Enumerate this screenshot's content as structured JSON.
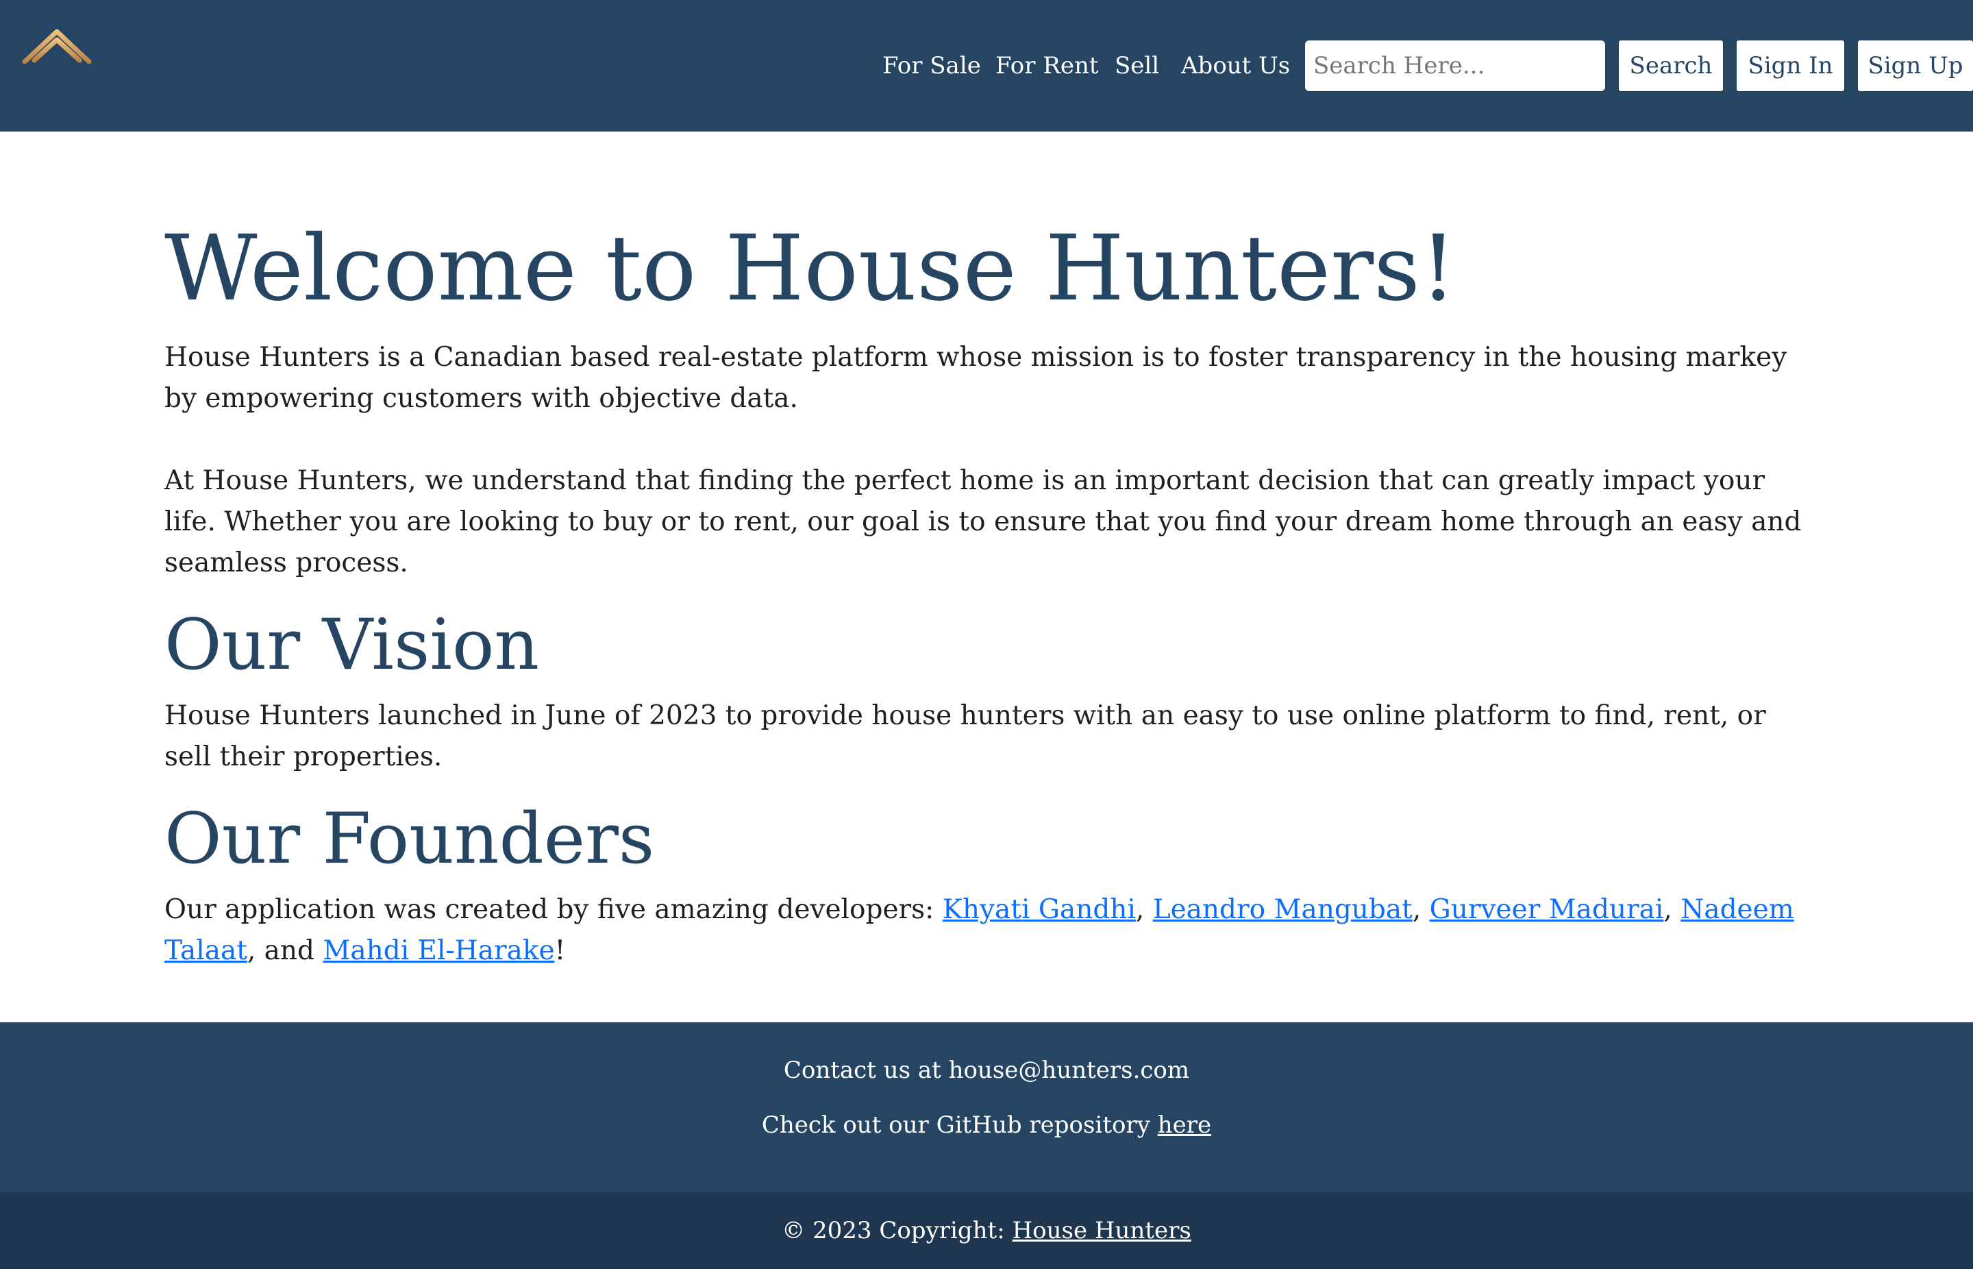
{
  "header": {
    "logo_icon": "house-hunters-logo-icon",
    "nav": {
      "for_sale": "For Sale",
      "for_rent": "For Rent",
      "sell": "Sell",
      "about_us": "About Us"
    },
    "search": {
      "placeholder": "Search Here...",
      "button_label": "Search"
    },
    "sign_in_label": "Sign In",
    "sign_up_label": "Sign Up"
  },
  "main": {
    "title": "Welcome to House Hunters!",
    "intro_paragraph_1": "House Hunters is a Canadian based real-estate platform whose mission is to foster transparency in the housing markey by empowering customers with objective data.",
    "intro_paragraph_2": "At House Hunters, we understand that finding the perfect home is an important decision that can greatly impact your life. Whether you are looking to buy or to rent, our goal is to ensure that you find your dream home through an easy and seamless process.",
    "vision": {
      "heading": "Our Vision",
      "text": "House Hunters launched in June of 2023 to provide house hunters with an easy to use online platform to find, rent, or sell their properties."
    },
    "founders": {
      "heading": "Our Founders",
      "intro": "Our application was created by five amazing developers: ",
      "names": [
        "Khyati Gandhi",
        "Leandro Mangubat",
        "Gurveer Madurai",
        "Nadeem Talaat",
        "Mahdi El-Harake"
      ],
      "sep_1": ", ",
      "sep_2": ", ",
      "sep_3": ", ",
      "sep_4": ", and ",
      "end": "!"
    }
  },
  "footer": {
    "contact": "Contact us at house@hunters.com",
    "github_prefix": "Check out our GitHub repository ",
    "github_link": "here",
    "copyright_prefix": "© 2023 Copyright: ",
    "copyright_link": "House Hunters"
  },
  "colors": {
    "brand_navy": "#264563",
    "footer_dark": "#1f3650",
    "link_blue": "#0d6efd",
    "logo_gold": "#d9a35f"
  }
}
